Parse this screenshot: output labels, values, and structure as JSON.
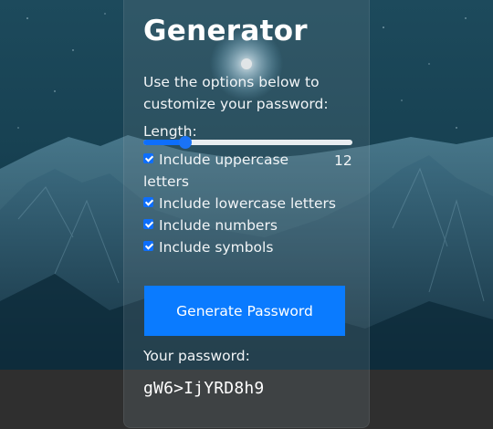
{
  "app": {
    "title": "Generator",
    "intro": "Use the options below to customize your password:"
  },
  "length": {
    "label": "Length:",
    "value": 12,
    "value_text": "12",
    "slider_fraction": 0.2
  },
  "options": [
    {
      "label": "Include uppercase letters",
      "checked": true
    },
    {
      "label": "Include lowercase letters",
      "checked": true
    },
    {
      "label": "Include numbers",
      "checked": true
    },
    {
      "label": "Include symbols",
      "checked": true
    }
  ],
  "button": {
    "label": "Generate Password"
  },
  "output": {
    "label": "Your password:",
    "password": "gW6>IjYRD8h9"
  },
  "colors": {
    "accent": "#0a7bff",
    "bottom_bar": "#2f2f2f"
  }
}
